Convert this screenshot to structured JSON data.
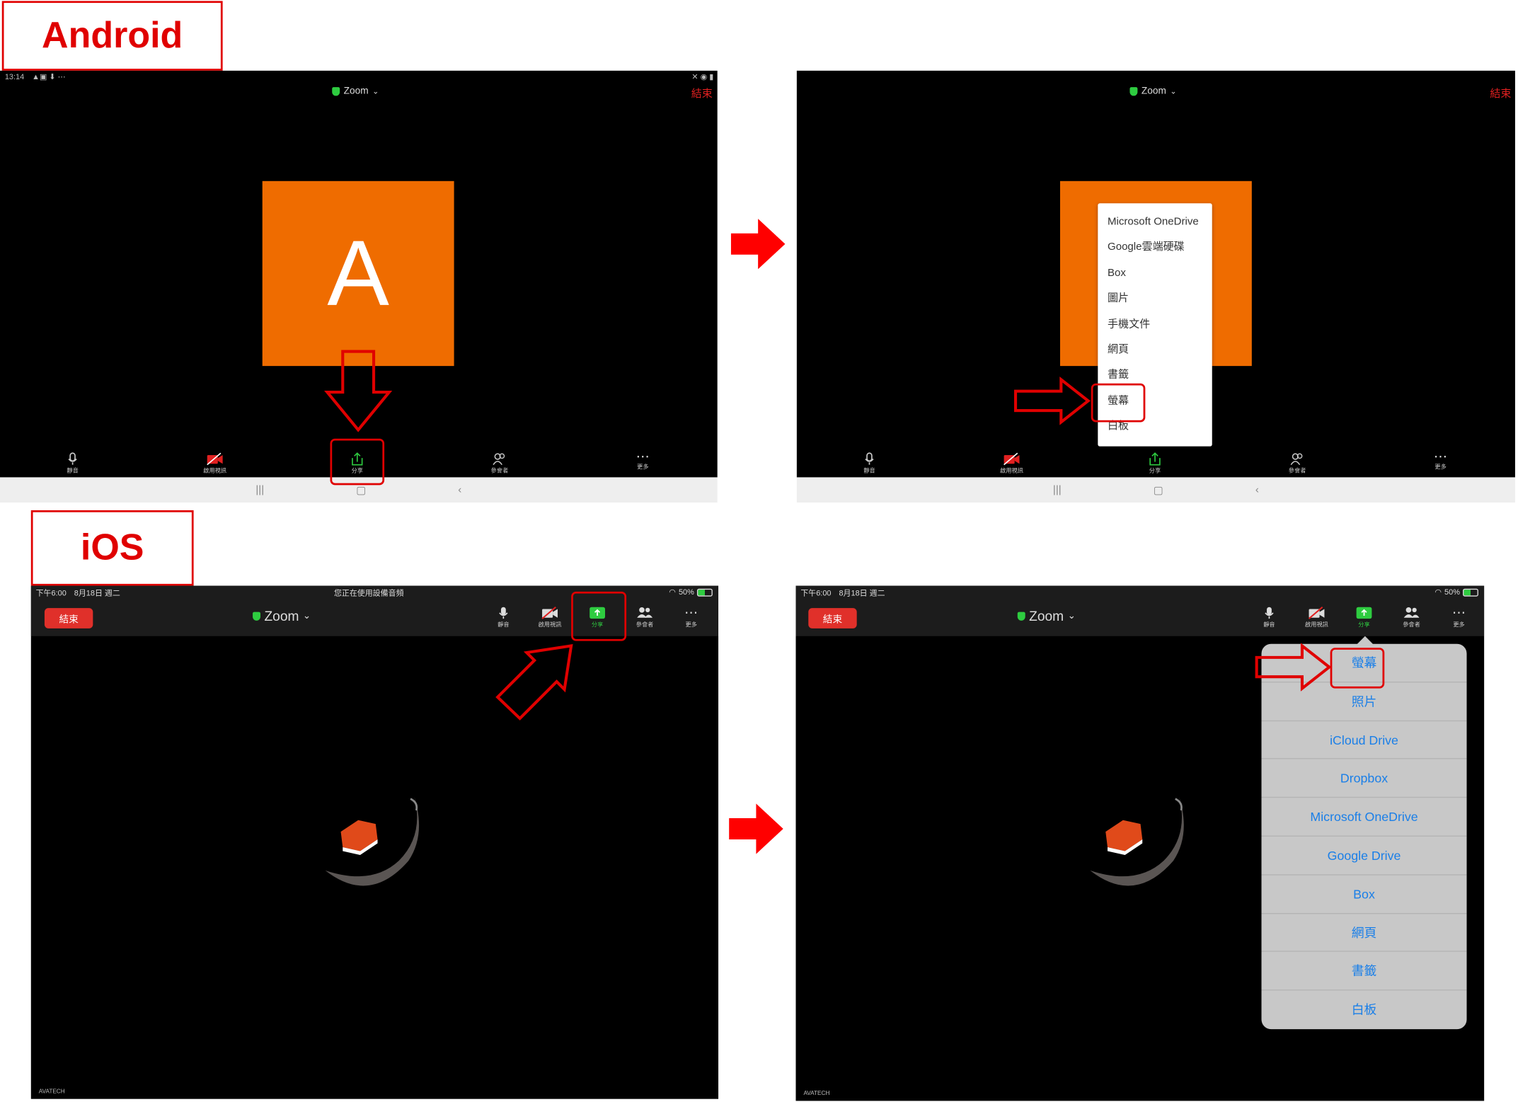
{
  "labels": {
    "android": "Android",
    "ios": "iOS"
  },
  "android_before": {
    "status_time": "13:14",
    "title": "Zoom",
    "end": "結束",
    "avatar_letter": "A",
    "toolbar": [
      "靜音",
      "啟用視訊",
      "分享",
      "參會者",
      "更多"
    ]
  },
  "android_after": {
    "title": "Zoom",
    "end": "結束",
    "menu": [
      "Microsoft OneDrive",
      "Google雲端硬碟",
      "Box",
      "圖片",
      "手機文件",
      "網頁",
      "書籤",
      "螢幕",
      "白板"
    ],
    "toolbar": [
      "靜音",
      "啟用視訊",
      "分享",
      "參會者",
      "更多"
    ]
  },
  "ios_before": {
    "status_left": "下午6:00　8月18日 週二",
    "status_center": "您正在使用設備音頻",
    "status_right": "50%",
    "end": "結束",
    "title": "Zoom",
    "toolbar": [
      "靜音",
      "啟用視訊",
      "分享",
      "參會者",
      "更多"
    ],
    "watermark": "AVATECH"
  },
  "ios_after": {
    "status_left": "下午6:00　8月18日 週二",
    "status_right": "50%",
    "end": "結束",
    "title": "Zoom",
    "toolbar": [
      "靜音",
      "啟用視訊",
      "分享",
      "參會者",
      "更多"
    ],
    "menu": [
      "螢幕",
      "照片",
      "iCloud Drive",
      "Dropbox",
      "Microsoft OneDrive",
      "Google Drive",
      "Box",
      "網頁",
      "書籤",
      "白板"
    ],
    "watermark": "AVATECH"
  },
  "colors": {
    "accent_red": "#e00000",
    "avatar_orange": "#ef6c00",
    "share_green": "#2ecc40",
    "ios_link_blue": "#1a7fe8"
  }
}
